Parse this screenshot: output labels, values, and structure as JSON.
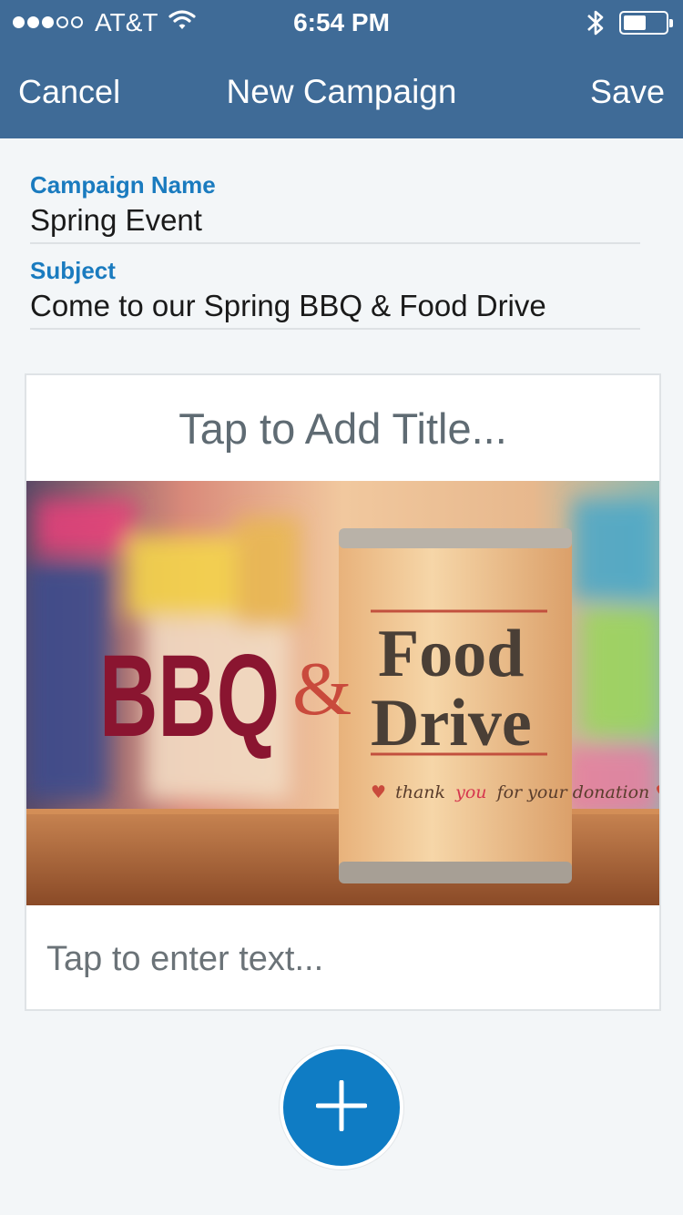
{
  "status_bar": {
    "carrier": "AT&T",
    "time": "6:54 PM",
    "signal_bars_filled": 3,
    "signal_bars_total": 5,
    "battery_level": 0.55
  },
  "nav": {
    "cancel_label": "Cancel",
    "title": "New Campaign",
    "save_label": "Save"
  },
  "form": {
    "campaign_name_label": "Campaign Name",
    "campaign_name_value": "Spring Event",
    "subject_label": "Subject",
    "subject_value": "Come to our Spring BBQ & Food Drive"
  },
  "card": {
    "title_placeholder": "Tap to Add Title...",
    "image": {
      "headline_left": "BBQ",
      "ampersand": "&",
      "can_line_1": "Food",
      "can_line_2": "Drive",
      "tagline_pre": "thank",
      "tagline_you": "you",
      "tagline_post": "for your donation"
    },
    "text_placeholder": "Tap to enter text..."
  },
  "fab": {
    "icon": "plus-icon"
  },
  "colors": {
    "header_bg": "#3f6b97",
    "accent": "#1a7bbf",
    "fab": "#0f7cc4",
    "bbq_text": "#8a1530",
    "ampersand": "#c94a3c"
  }
}
